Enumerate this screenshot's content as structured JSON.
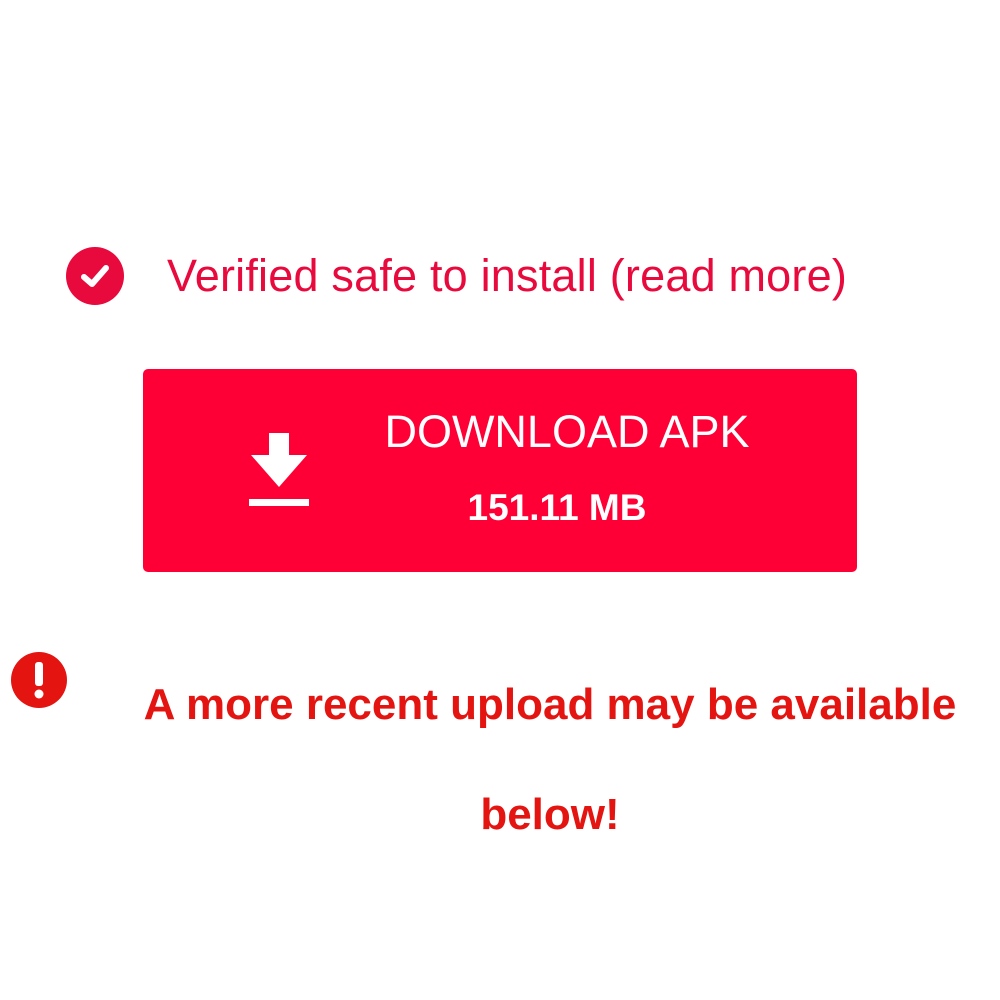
{
  "verified": {
    "text": "Verified safe to install (read more)",
    "icon": "check-circle-icon"
  },
  "download_button": {
    "title": "DOWNLOAD APK",
    "size": "151.11 MB",
    "icon": "download-arrow-icon"
  },
  "notice": {
    "text": "A more recent upload may be available below!",
    "icon": "exclamation-circle-icon"
  },
  "colors": {
    "verified": "#e8093d",
    "button_background": "#ff0036",
    "button_text": "#ffffff",
    "notice": "#e41411",
    "page_background": "#ffffff"
  }
}
